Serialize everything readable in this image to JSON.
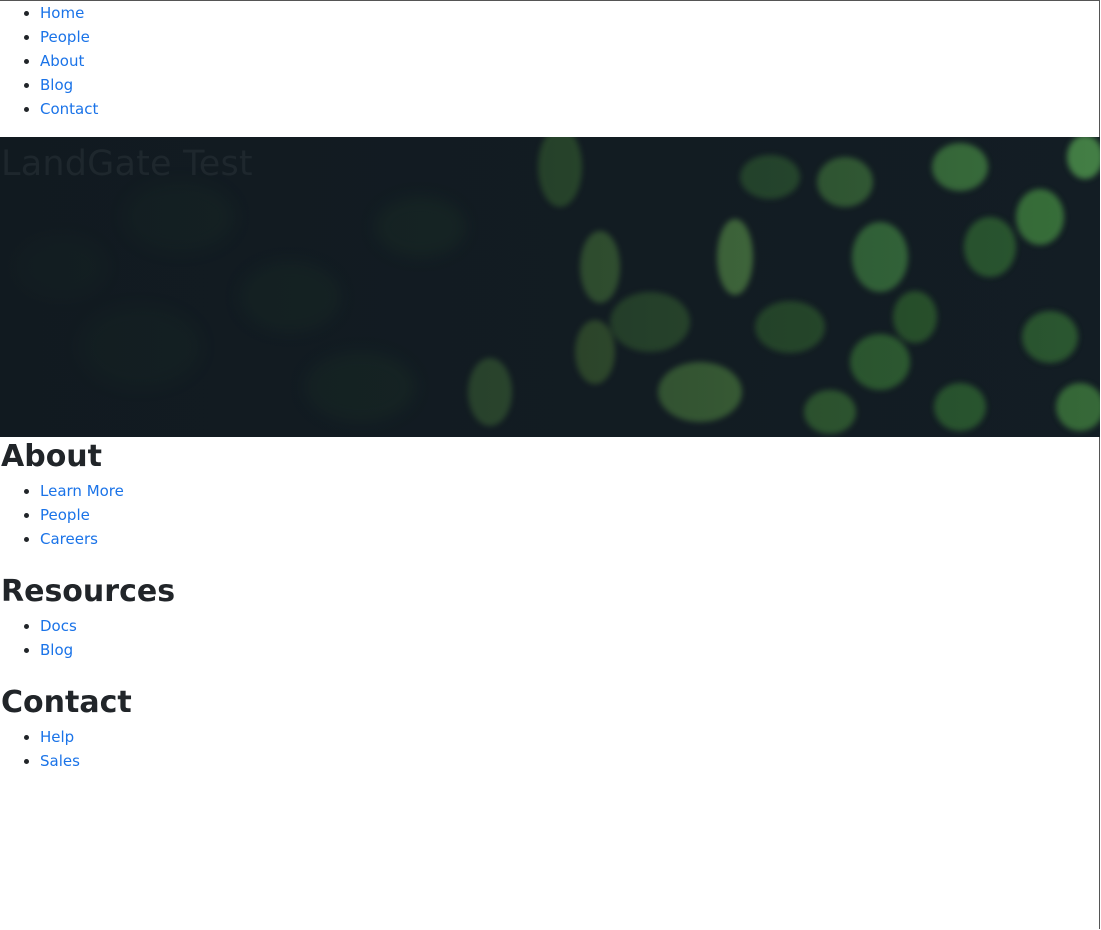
{
  "topnav": {
    "items": [
      {
        "label": "Home"
      },
      {
        "label": "People"
      },
      {
        "label": "About"
      },
      {
        "label": "Blog"
      },
      {
        "label": "Contact"
      }
    ]
  },
  "hero": {
    "title": "LandGate Test",
    "colors": {
      "background": "#131d24",
      "leaf": "#3f7a3c",
      "title": "#1e272d"
    }
  },
  "footer": {
    "about": {
      "heading": "About",
      "items": [
        {
          "label": "Learn More"
        },
        {
          "label": "People"
        },
        {
          "label": "Careers"
        }
      ]
    },
    "resources": {
      "heading": "Resources",
      "items": [
        {
          "label": "Docs"
        },
        {
          "label": "Blog"
        }
      ]
    },
    "contact": {
      "heading": "Contact",
      "items": [
        {
          "label": "Help"
        },
        {
          "label": "Sales"
        }
      ]
    }
  },
  "colors": {
    "link": "#1a73e8",
    "text": "#212529"
  }
}
